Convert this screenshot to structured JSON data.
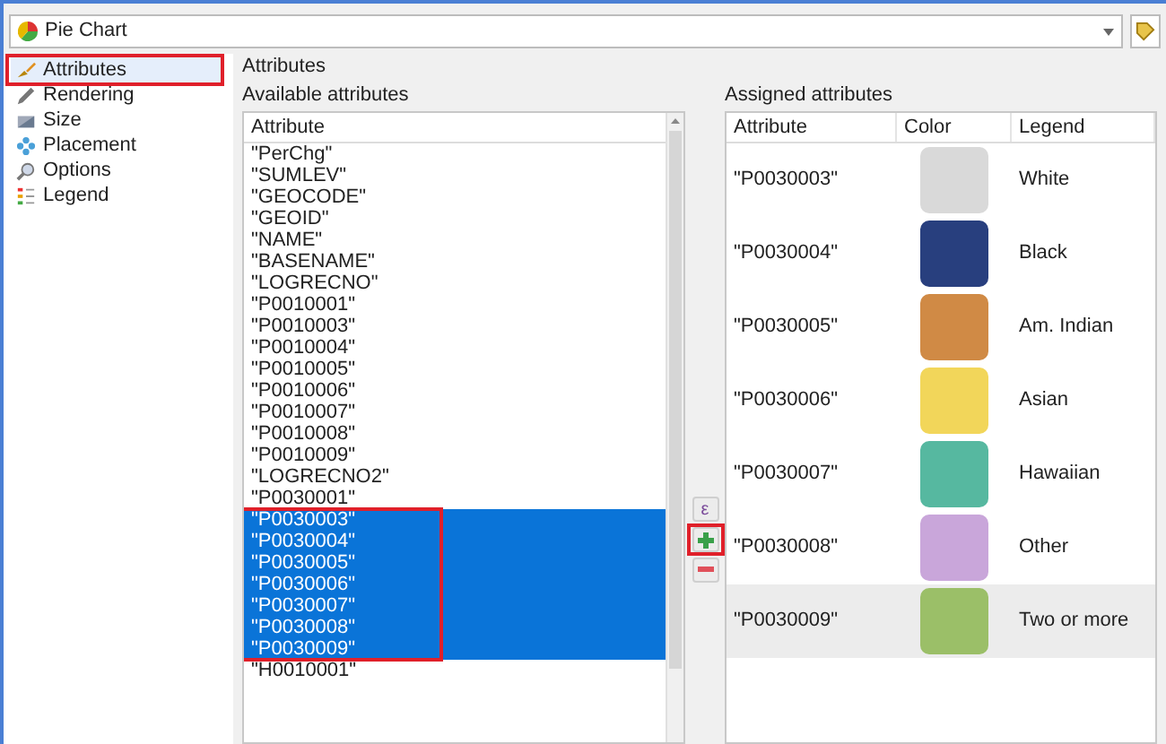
{
  "renderer": {
    "label": "Pie Chart"
  },
  "sidebar": {
    "items": [
      {
        "label": "Attributes",
        "selected": true,
        "callout": true
      },
      {
        "label": "Rendering",
        "selected": false,
        "callout": false
      },
      {
        "label": "Size",
        "selected": false,
        "callout": false
      },
      {
        "label": "Placement",
        "selected": false,
        "callout": false
      },
      {
        "label": "Options",
        "selected": false,
        "callout": false
      },
      {
        "label": "Legend",
        "selected": false,
        "callout": false
      }
    ]
  },
  "section_title": "Attributes",
  "available": {
    "title": "Available attributes",
    "column": "Attribute",
    "selection_callout": true,
    "items": [
      {
        "label": "\"PerChg\"",
        "selected": false
      },
      {
        "label": "\"SUMLEV\"",
        "selected": false
      },
      {
        "label": "\"GEOCODE\"",
        "selected": false
      },
      {
        "label": "\"GEOID\"",
        "selected": false
      },
      {
        "label": "\"NAME\"",
        "selected": false
      },
      {
        "label": "\"BASENAME\"",
        "selected": false
      },
      {
        "label": "\"LOGRECNO\"",
        "selected": false
      },
      {
        "label": "\"P0010001\"",
        "selected": false
      },
      {
        "label": "\"P0010003\"",
        "selected": false
      },
      {
        "label": "\"P0010004\"",
        "selected": false
      },
      {
        "label": "\"P0010005\"",
        "selected": false
      },
      {
        "label": "\"P0010006\"",
        "selected": false
      },
      {
        "label": "\"P0010007\"",
        "selected": false
      },
      {
        "label": "\"P0010008\"",
        "selected": false
      },
      {
        "label": "\"P0010009\"",
        "selected": false
      },
      {
        "label": "\"LOGRECNO2\"",
        "selected": false
      },
      {
        "label": "\"P0030001\"",
        "selected": false
      },
      {
        "label": "\"P0030003\"",
        "selected": true
      },
      {
        "label": "\"P0030004\"",
        "selected": true
      },
      {
        "label": "\"P0030005\"",
        "selected": true
      },
      {
        "label": "\"P0030006\"",
        "selected": true
      },
      {
        "label": "\"P0030007\"",
        "selected": true
      },
      {
        "label": "\"P0030008\"",
        "selected": true
      },
      {
        "label": "\"P0030009\"",
        "selected": true
      },
      {
        "label": "\"H0010001\"",
        "selected": false
      }
    ]
  },
  "buttons": [
    {
      "kind": "expression",
      "label": "ε",
      "callout": false
    },
    {
      "kind": "add",
      "callout": true
    },
    {
      "kind": "remove",
      "callout": false
    }
  ],
  "assigned": {
    "title": "Assigned attributes",
    "columns": [
      "Attribute",
      "Color",
      "Legend"
    ],
    "rows": [
      {
        "attribute": "\"P0030003\"",
        "color": "#d9d9d9",
        "legend": "White",
        "selected": false
      },
      {
        "attribute": "\"P0030004\"",
        "color": "#283f7e",
        "legend": "Black",
        "selected": false
      },
      {
        "attribute": "\"P0030005\"",
        "color": "#d08a45",
        "legend": "Am. Indian",
        "selected": false
      },
      {
        "attribute": "\"P0030006\"",
        "color": "#f2d65a",
        "legend": "Asian",
        "selected": false
      },
      {
        "attribute": "\"P0030007\"",
        "color": "#56b8a0",
        "legend": "Hawaiian",
        "selected": false
      },
      {
        "attribute": "\"P0030008\"",
        "color": "#c9a6da",
        "legend": "Other",
        "selected": false
      },
      {
        "attribute": "\"P0030009\"",
        "color": "#9bbf68",
        "legend": "Two or more",
        "selected": true
      }
    ]
  }
}
